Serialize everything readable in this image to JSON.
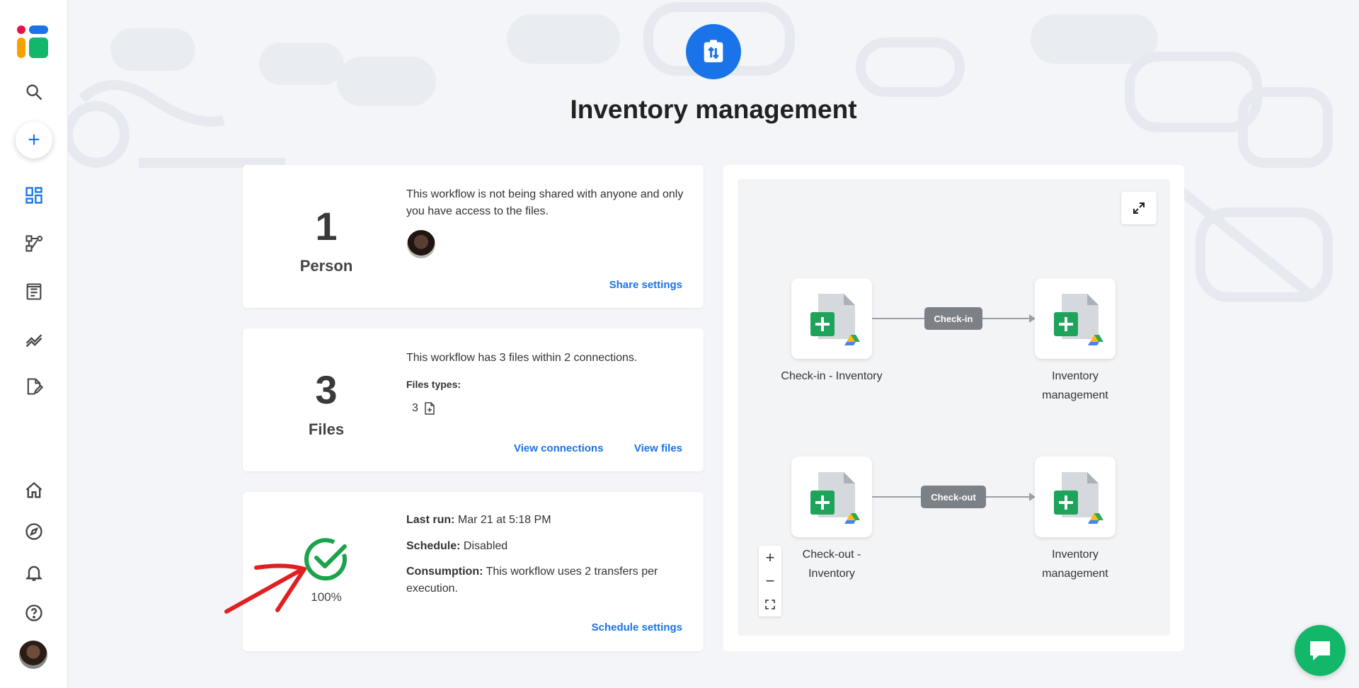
{
  "header": {
    "title": "Inventory management"
  },
  "sharing_card": {
    "count": "1",
    "count_label": "Person",
    "description": "This workflow is not being shared with anyone and only you have access to the files.",
    "link": "Share settings"
  },
  "files_card": {
    "count": "3",
    "count_label": "Files",
    "description": "This workflow has 3 files within 2 connections.",
    "types_label": "Files types:",
    "types_count": "3",
    "link_connections": "View connections",
    "link_files": "View files"
  },
  "status_card": {
    "percent": "100%",
    "last_run_label": "Last run:",
    "last_run_value": "Mar 21 at 5:18 PM",
    "schedule_label": "Schedule:",
    "schedule_value": "Disabled",
    "consumption_label": "Consumption:",
    "consumption_value": "This workflow uses 2 transfers per execution.",
    "link": "Schedule settings"
  },
  "diagram": {
    "connections": [
      {
        "label": "Check-in",
        "source": "Check-in - Inventory",
        "target": "Inventory management"
      },
      {
        "label": "Check-out",
        "source": "Check-out - Inventory",
        "target": "Inventory management"
      }
    ],
    "zoom_in": "+",
    "zoom_out": "−"
  },
  "colors": {
    "accent": "#1a73e8",
    "success": "#1aa34a",
    "chat": "#12b76a",
    "annotation": "#e02020"
  }
}
